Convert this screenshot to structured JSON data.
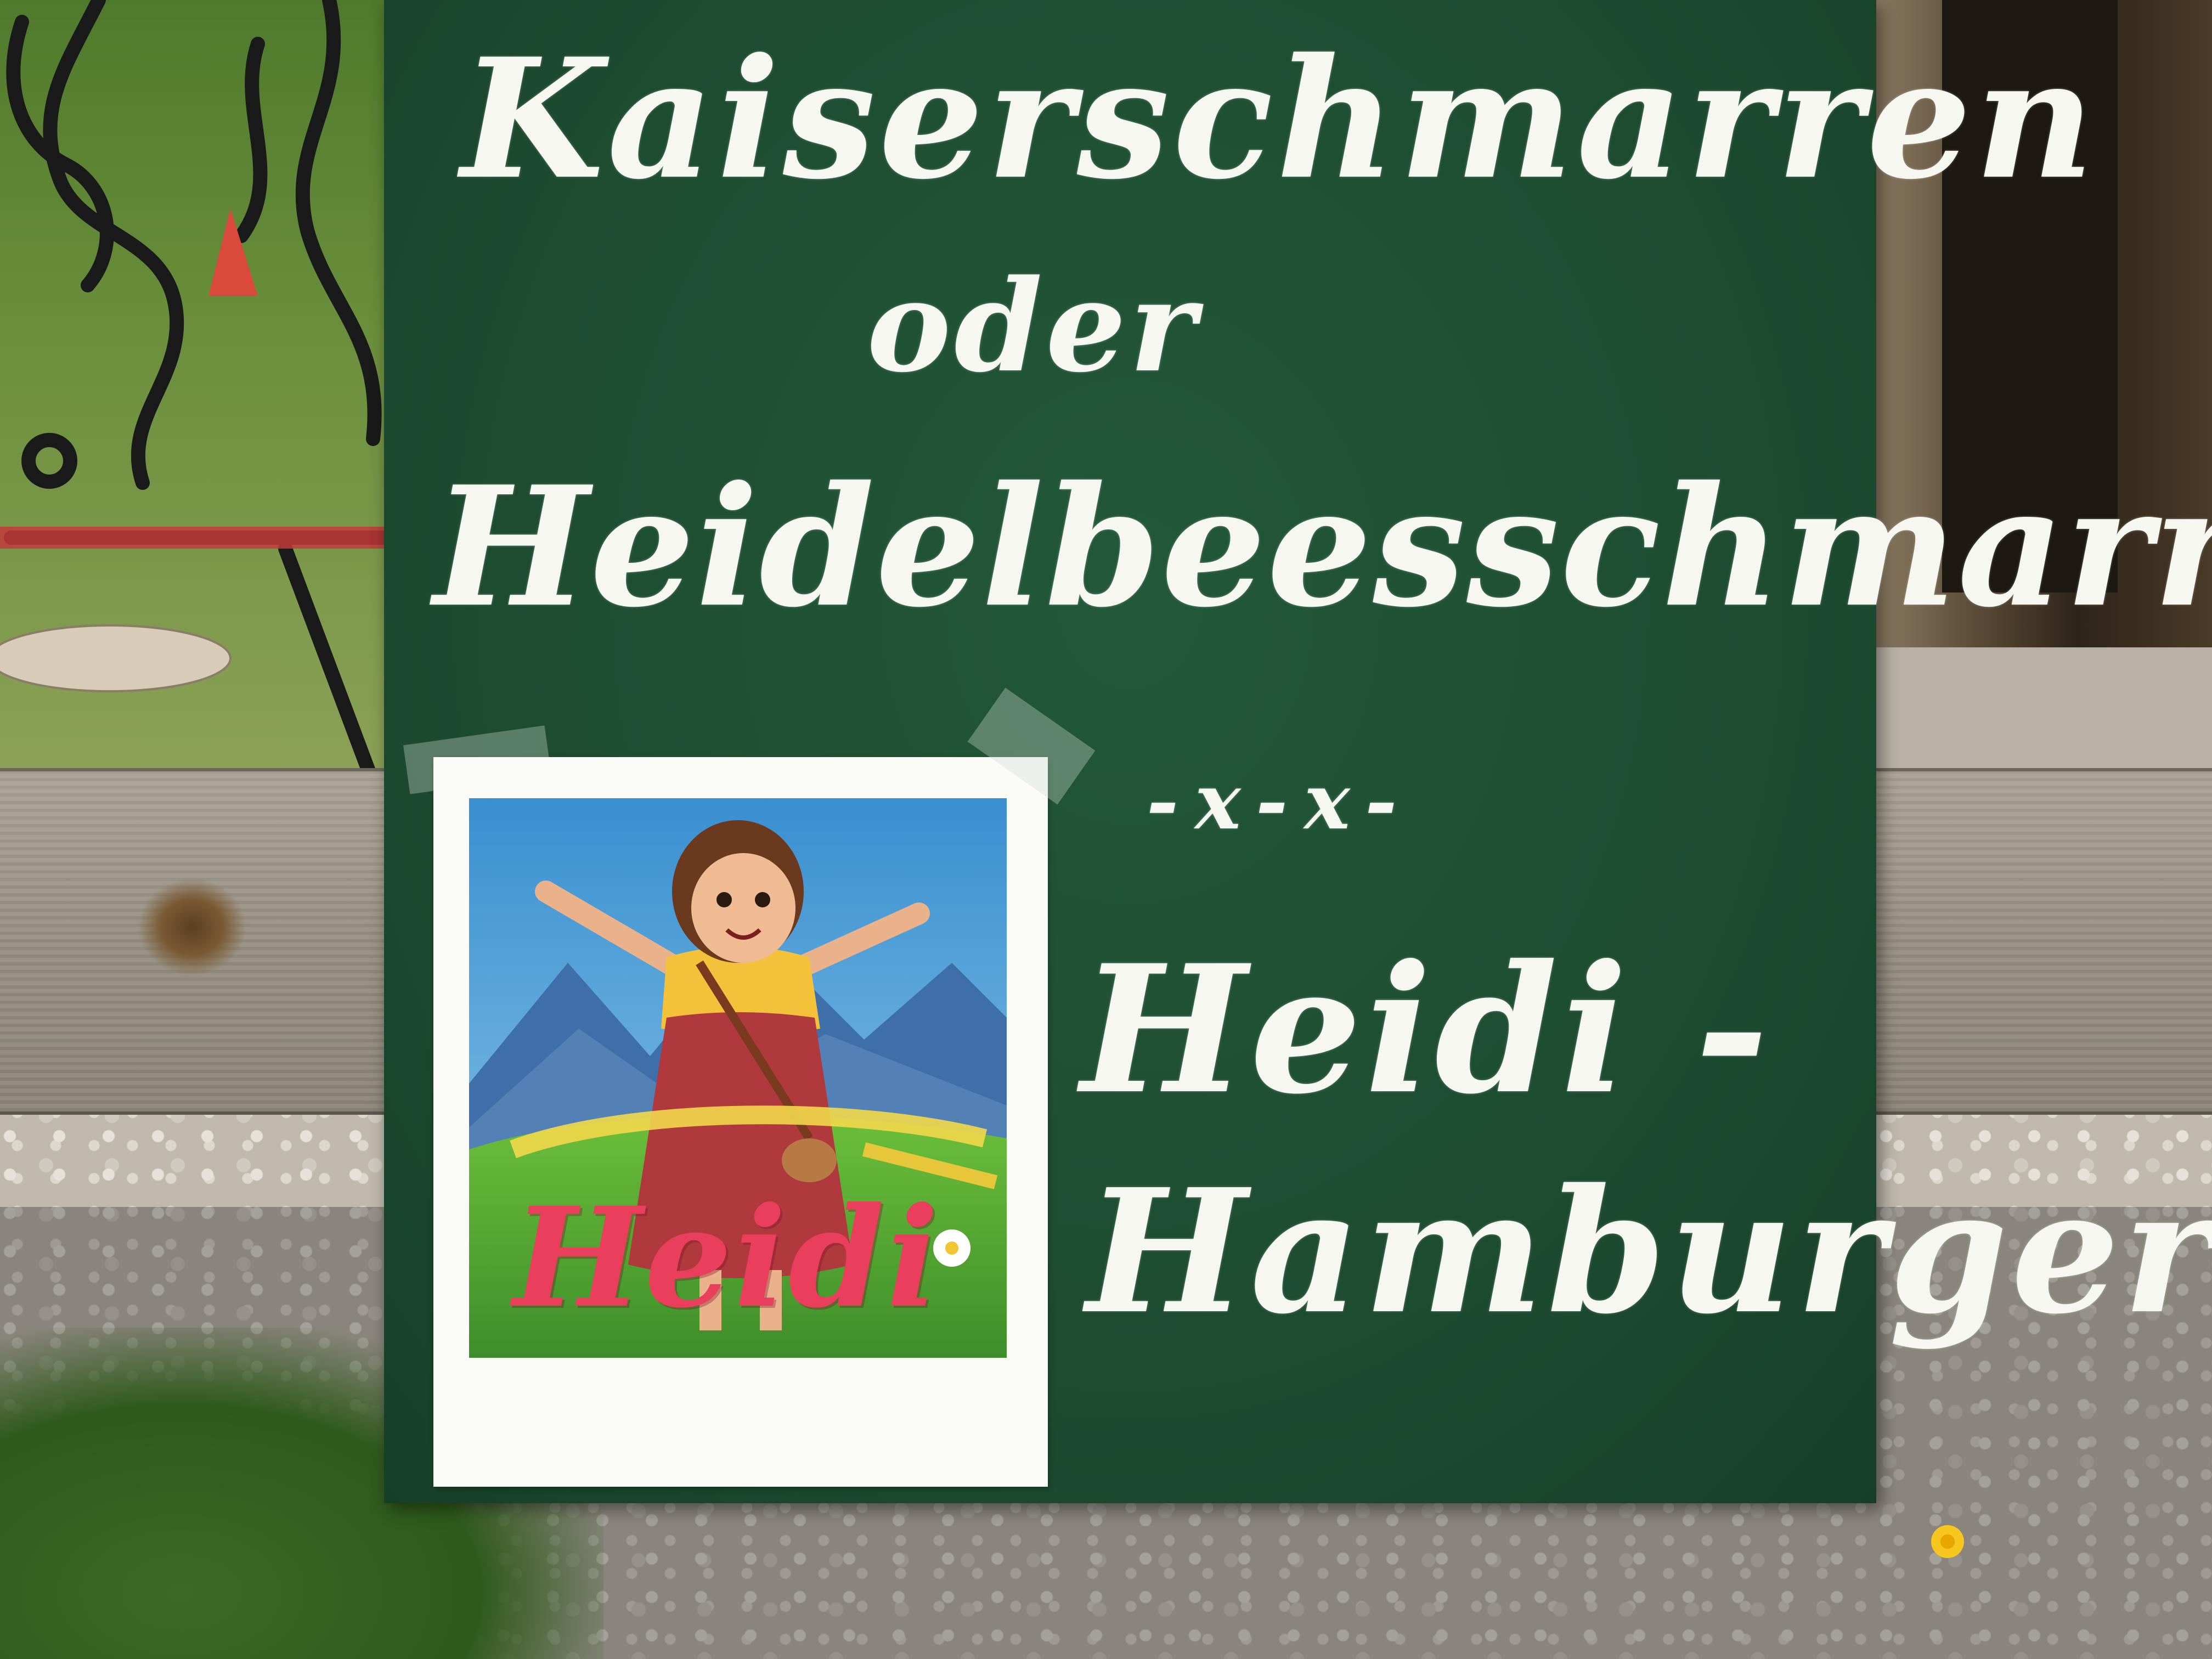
{
  "sign": {
    "line1": "Kaiserschmarren",
    "line2": "oder",
    "line3": "Heidelbeesschmarren",
    "divider": "-x-x-",
    "line4": "Heidi -",
    "line5": "Hamburger"
  },
  "poster": {
    "title": "Heidi"
  },
  "colors": {
    "chalkboard": "#1d4c31",
    "chalk": "#f7f7f2",
    "poster_title": "#ea3f5c"
  }
}
